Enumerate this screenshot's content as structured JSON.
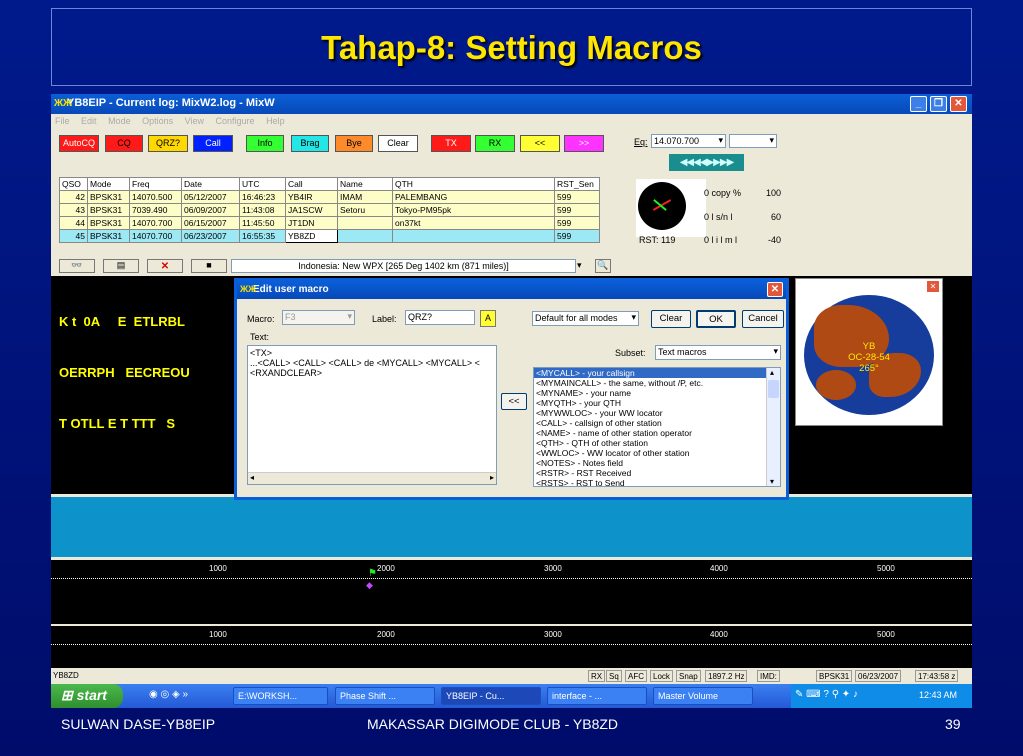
{
  "slide": {
    "title": "Tahap-8: Setting Macros",
    "footer_left": "SULWAN DASE-YB8EIP",
    "footer_center": "MAKASSAR DIGIMODE CLUB - YB8ZD",
    "footer_right": "39"
  },
  "window": {
    "title": "YB8EIP - Current log: MixW2.log - MixW",
    "menu": [
      "File",
      "Edit",
      "Mode",
      "Options",
      "View",
      "Configure",
      "Help"
    ],
    "controls": {
      "minimize": "_",
      "restore": "❐",
      "close": "✕"
    }
  },
  "macro_buttons": [
    {
      "label": "AutoCQ",
      "color": "#ff1a1a",
      "text": "#fff"
    },
    {
      "label": "CQ",
      "color": "#ff1a1a",
      "text": "#000"
    },
    {
      "label": "QRZ?",
      "color": "#ffd800",
      "text": "#000"
    },
    {
      "label": "Call",
      "color": "#0020ff",
      "text": "#fff"
    },
    {
      "label": "Info",
      "color": "#33ff33",
      "text": "#000"
    },
    {
      "label": "Brag",
      "color": "#23e7e7",
      "text": "#000"
    },
    {
      "label": "Bye",
      "color": "#ff8a2a",
      "text": "#000"
    },
    {
      "label": "Clear",
      "color": "#ffffff",
      "text": "#000"
    },
    {
      "label": "TX",
      "color": "#ff1a1a",
      "text": "#fff"
    },
    {
      "label": "RX",
      "color": "#33ff33",
      "text": "#000"
    },
    {
      "label": "<<",
      "color": "#ffff33",
      "text": "#000"
    },
    {
      "label": ">>",
      "color": "#ff33ff",
      "text": "#fff"
    }
  ],
  "freq": {
    "label": "Eq:",
    "value": "14.070.700",
    "second_value": "",
    "nav": "◀◀◀◀▶▶▶▶"
  },
  "log_table": {
    "headers": [
      "QSO",
      "Mode",
      "Freq",
      "Date",
      "UTC",
      "Call",
      "Name",
      "QTH",
      "RST_Sen"
    ],
    "rows": [
      [
        "42",
        "BPSK31",
        "14070.500",
        "05/12/2007",
        "16:46:23",
        "YB4IR",
        "IMAM",
        "PALEMBANG",
        "599"
      ],
      [
        "43",
        "BPSK31",
        "7039.490",
        "06/09/2007",
        "11:43:08",
        "JA1SCW",
        "Setoru",
        "Tokyo-PM95pk",
        "599"
      ],
      [
        "44",
        "BPSK31",
        "14070.700",
        "06/15/2007",
        "11:45:50",
        "JT1DN",
        "",
        "on37kt",
        "599"
      ],
      [
        "45",
        "BPSK31",
        "14070.700",
        "06/23/2007",
        "16:55:35",
        "YB8ZD",
        "",
        "",
        "599"
      ]
    ]
  },
  "log_toolbar": {
    "info": "Indonesia:  New WPX [265 Deg  1402 km (871 miles)]"
  },
  "meters": {
    "copy_label": "0   copy %",
    "copy_max": "100",
    "sn_label": "0     l s/n l",
    "sn_max": "60",
    "rst_label": "RST: 119",
    "imd_label": "0    l  i  l m  l",
    "imd_max": "-40"
  },
  "rx_text": {
    "line1": "K t  0A     E  ETLRBL",
    "line2": "OERRPH   EECREOU",
    "line3": "T OTLL E T TTT   S"
  },
  "globe": {
    "line1": "YB",
    "line2": "OC-28-54",
    "line3": "265°"
  },
  "ruler_ticks": [
    "1000",
    "2000",
    "3000",
    "4000",
    "5000"
  ],
  "status": {
    "call": "YB8ZD",
    "rx": "RX",
    "sq": "Sq",
    "afc": "AFC",
    "lock": "Lock",
    "snap": "Snap",
    "hz": "1897.2 Hz",
    "imd": "IMD:",
    "mode": "BPSK31",
    "date": "06/23/2007",
    "time": "17:43:58 z"
  },
  "taskbar": {
    "start": "start",
    "items": [
      "E:\\WORKSH...",
      "Phase Shift ...",
      "YB8EIP - Cu...",
      "interface - ...",
      "Master Volume"
    ],
    "clock": "12:43 AM"
  },
  "dialog": {
    "title": "Edit user macro",
    "macro_label": "Macro:",
    "macro_value": "F3",
    "label_label": "Label:",
    "label_value": "QRZ?",
    "color_btn": "A",
    "mode_select": "Default for all modes",
    "clear_btn": "Clear",
    "ok_btn": "OK",
    "cancel_btn": "Cancel",
    "text_label": "Text:",
    "text_lines": [
      "<TX>",
      "...<CALL> <CALL> <CALL>  de <MYCALL> <MYCALL> <",
      "<RXANDCLEAR>"
    ],
    "insert_btn": "<<",
    "subset_label": "Subset:",
    "subset_value": "Text macros",
    "macro_list": [
      "<MYCALL> - your callsign",
      "<MYMAINCALL> - the same, without /P, etc.",
      "<MYNAME> - your name",
      "<MYQTH> - your QTH",
      "<MYWWLOC> - your WW locator",
      "<CALL> - callsign of other station",
      "<NAME> - name of other station operator",
      "<QTH> - QTH of other station",
      "<WWLOC> - WW locator of other station",
      "<NOTES> - Notes field",
      "<RSTR> - RST Received",
      "<RSTS> - RST to Send"
    ]
  }
}
